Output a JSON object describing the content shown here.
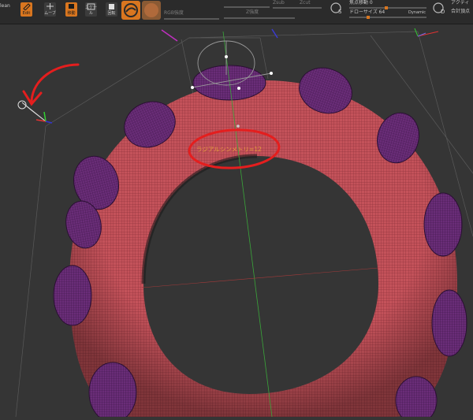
{
  "toolbar": {
    "left_label": "lean",
    "buttons": [
      {
        "label": "Edit",
        "active": true
      },
      {
        "label": "ムーブ",
        "active": false
      },
      {
        "label": "移動",
        "active": true
      },
      {
        "label": "スケール",
        "active": false
      },
      {
        "label": "回転",
        "active": false
      }
    ],
    "rgb_label": "RGB強度",
    "z_intensity_label": "Z強度",
    "zsub_label": "Zsub",
    "zcut_label": "Zcut",
    "focal_shift_label": "焦点移動 0",
    "draw_size_label": "ドローサイズ 64",
    "dynamic_label": "Dynamic",
    "active_points_label": "アクティ",
    "total_points_label": "合計頂点",
    "s_button": "S",
    "d_button": "D"
  },
  "viewport": {
    "symmetry_label": "ラジアルシンメトリ=12"
  },
  "colors": {
    "accent": "#d9761f",
    "torus": "#c4525a",
    "bumps": "#6a2d78",
    "annotation": "#e41e1e",
    "symmetry_text": "#e5a03c"
  }
}
